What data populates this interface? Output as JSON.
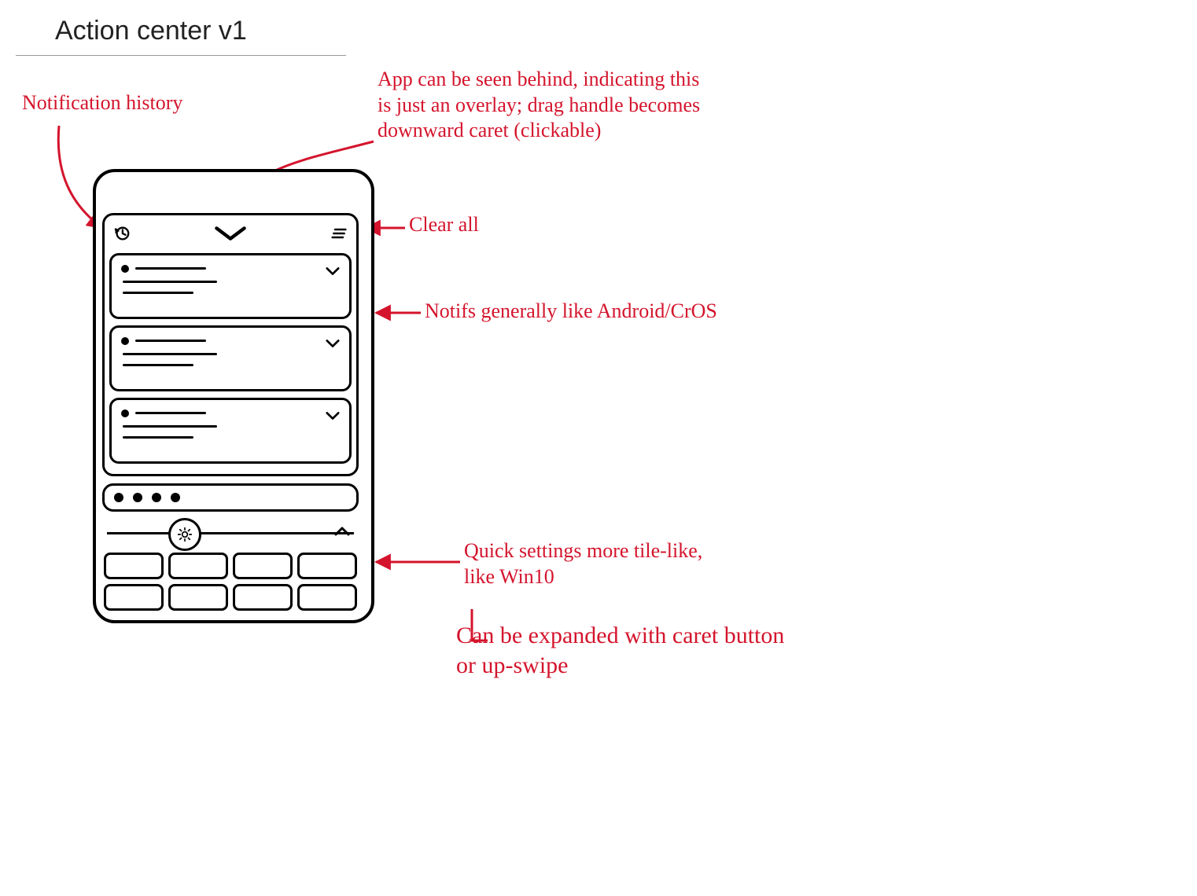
{
  "title": "Action center v1",
  "annotations": {
    "history": "Notification history",
    "overlay": "App can be seen behind, indicating this\nis just an overlay; drag handle becomes\ndownward caret (clickable)",
    "clear_all": "Clear all",
    "notifs": "Notifs generally like Android/CrOS",
    "quick_settings": "Quick settings more tile-like,\nlike Win10",
    "expandable": "Can be expanded with caret button\nor up-swipe"
  },
  "phone": {
    "header": {
      "history_icon": "history-icon",
      "drag_handle_icon": "chevron-down-icon",
      "clear_all_icon": "clear-all-icon"
    },
    "notifications_count": 3,
    "pager_dots": 4,
    "brightness_slider_icon": "brightness-icon",
    "expand_icon": "chevron-up-icon",
    "quick_tiles_count": 8
  }
}
